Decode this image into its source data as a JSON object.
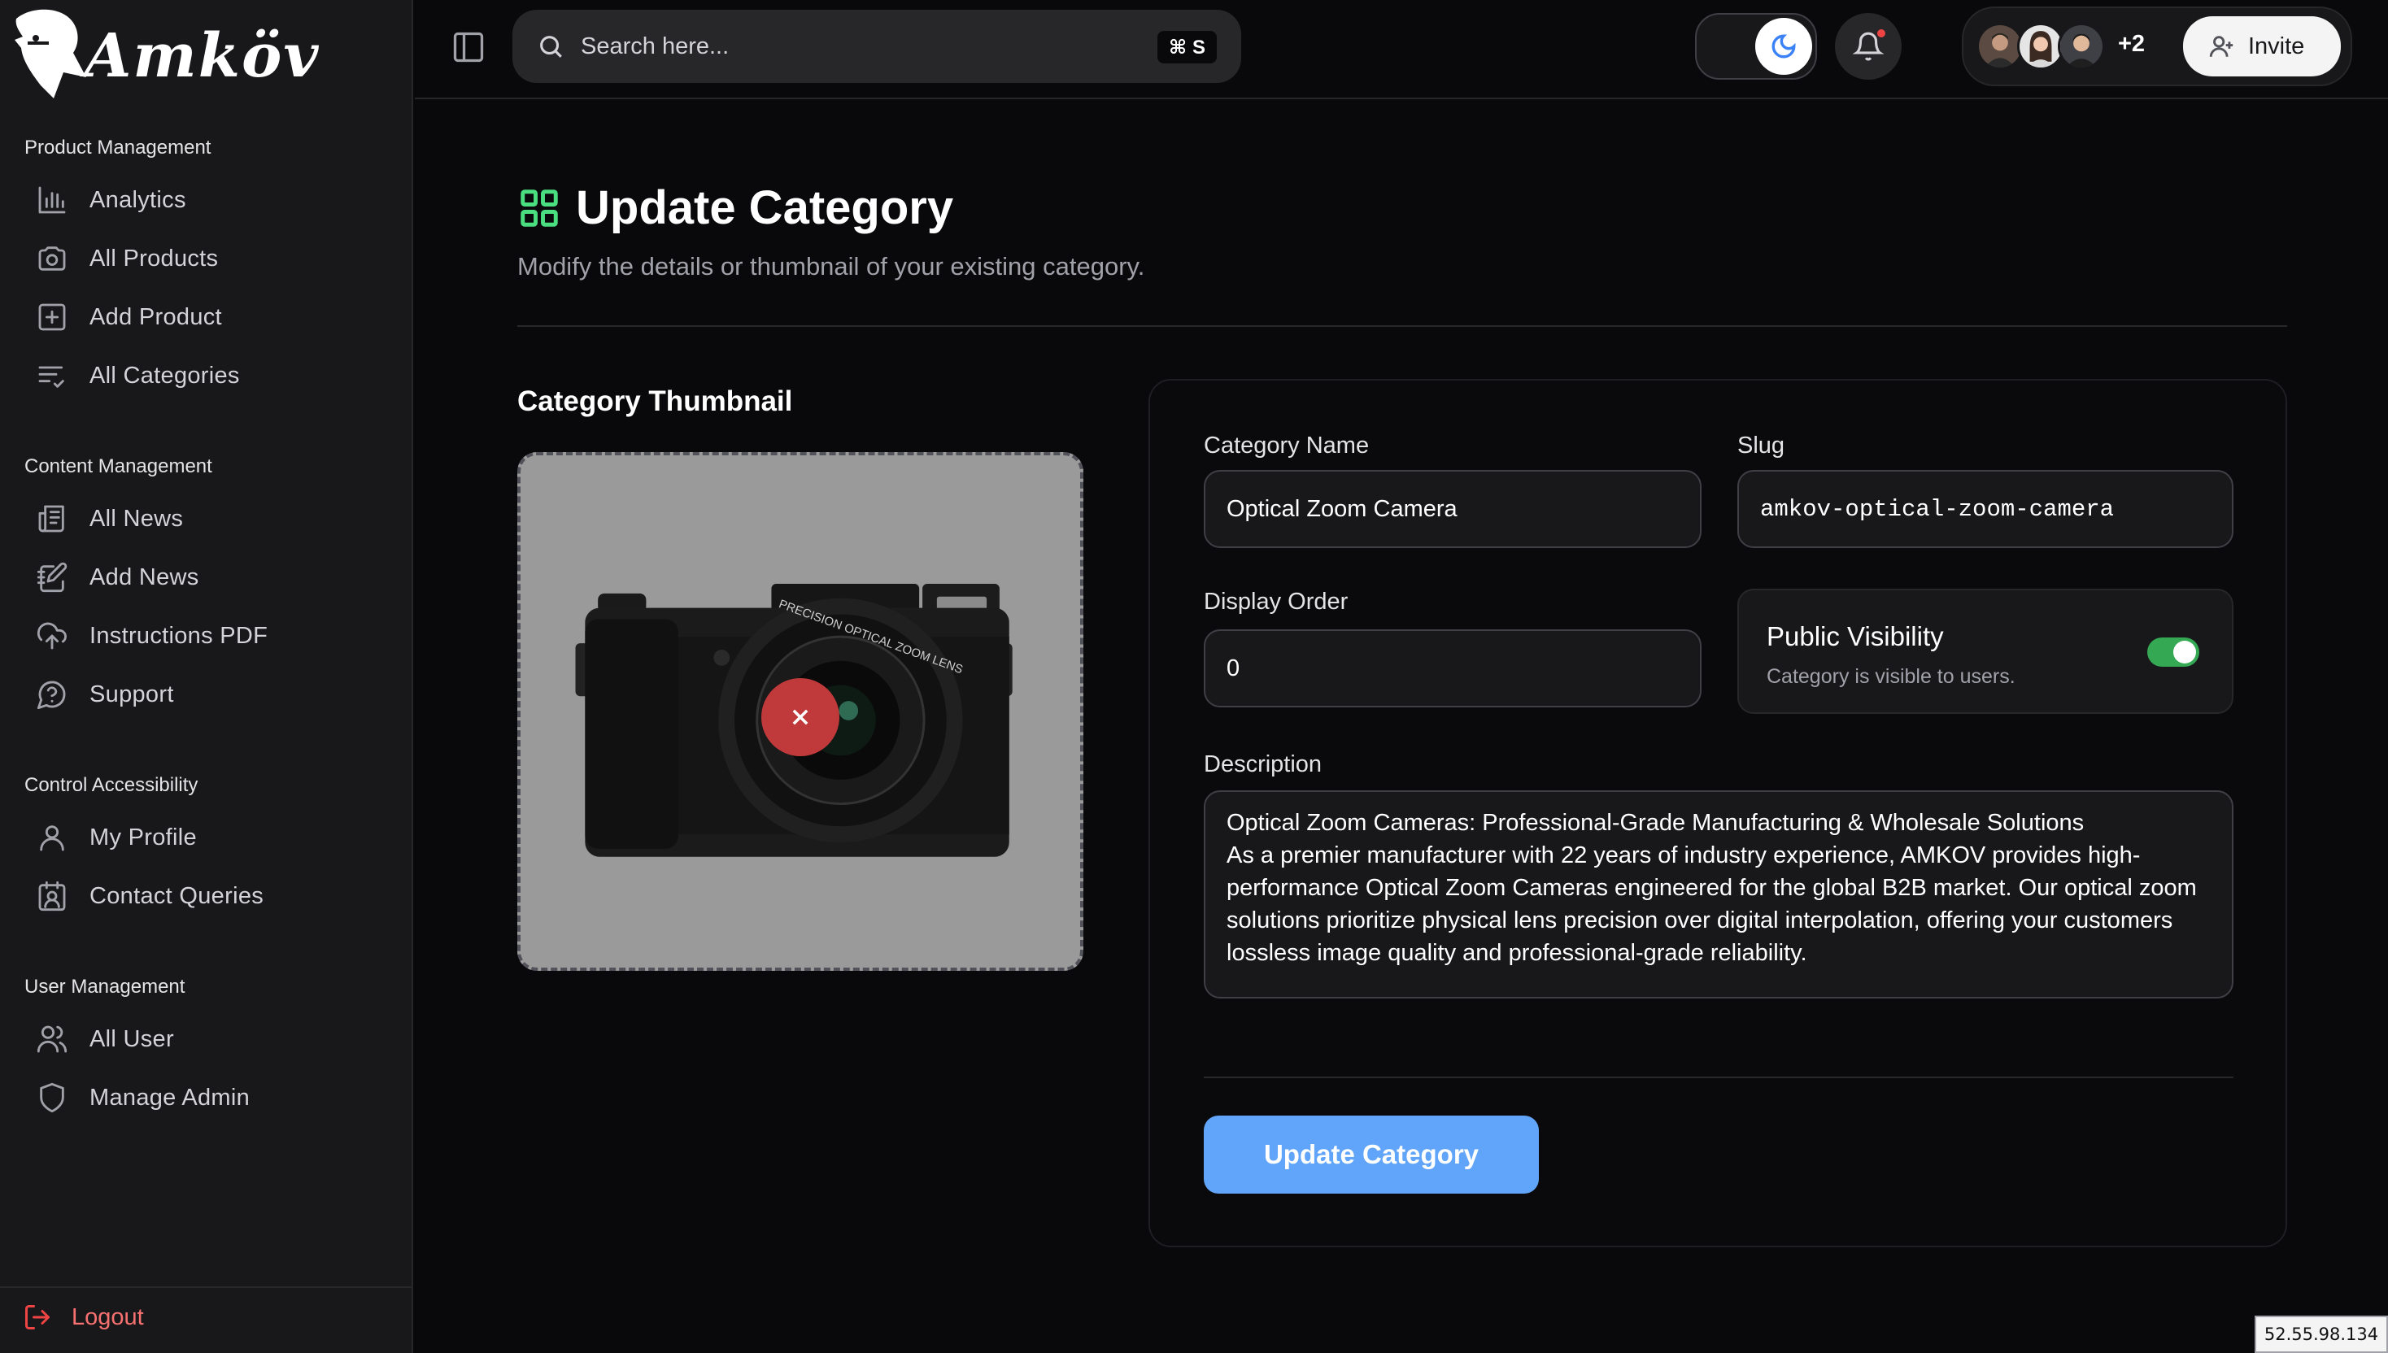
{
  "brand": {
    "name": "Amköv"
  },
  "sidebar": {
    "sections": [
      {
        "title": "Product Management",
        "items": [
          {
            "label": "Analytics",
            "icon": "bar-chart-icon"
          },
          {
            "label": "All Products",
            "icon": "camera-icon"
          },
          {
            "label": "Add Product",
            "icon": "plus-square-icon"
          },
          {
            "label": "All Categories",
            "icon": "list-check-icon"
          }
        ]
      },
      {
        "title": "Content Management",
        "items": [
          {
            "label": "All News",
            "icon": "newspaper-icon"
          },
          {
            "label": "Add News",
            "icon": "notebook-pen-icon"
          },
          {
            "label": "Instructions PDF",
            "icon": "cloud-upload-icon"
          },
          {
            "label": "Support",
            "icon": "help-circle-icon"
          }
        ]
      },
      {
        "title": "Control Accessibility",
        "items": [
          {
            "label": "My Profile",
            "icon": "user-icon"
          },
          {
            "label": "Contact Queries",
            "icon": "contact-icon"
          }
        ]
      },
      {
        "title": "User Management",
        "items": [
          {
            "label": "All User",
            "icon": "users-icon"
          },
          {
            "label": "Manage Admin",
            "icon": "shield-icon"
          }
        ]
      }
    ],
    "logout_label": "Logout"
  },
  "topbar": {
    "search_placeholder": "Search here...",
    "search_shortcut": "⌘ S",
    "extra_members": "+2",
    "invite_label": "Invite"
  },
  "page": {
    "title": "Update Category",
    "subtitle": "Modify the details or thumbnail of your existing category."
  },
  "thumbnail": {
    "title": "Category Thumbnail",
    "lens_text": "PRECISION OPTICAL ZOOM LENS"
  },
  "form": {
    "name_label": "Category Name",
    "name_value": "Optical Zoom Camera",
    "slug_label": "Slug",
    "slug_value": "amkov-optical-zoom-camera",
    "order_label": "Display Order",
    "order_value": "0",
    "visibility_title": "Public Visibility",
    "visibility_sub": "Category is visible to users.",
    "visibility_on": true,
    "description_label": "Description",
    "description_value": "Optical Zoom Cameras: Professional-Grade Manufacturing & Wholesale Solutions\nAs a premier manufacturer with 22 years of industry experience, AMKOV provides high-performance Optical Zoom Cameras engineered for the global B2B market. Our optical zoom solutions prioritize physical lens precision over digital interpolation, offering your customers lossless image quality and professional-grade reliability.",
    "submit_label": "Update Category"
  },
  "ip_address": "52.55.98.134",
  "colors": {
    "accent_green": "#4ade80",
    "submit_blue": "#60a5fa",
    "logout_red": "#f87171",
    "toggle_green": "#34a853"
  }
}
